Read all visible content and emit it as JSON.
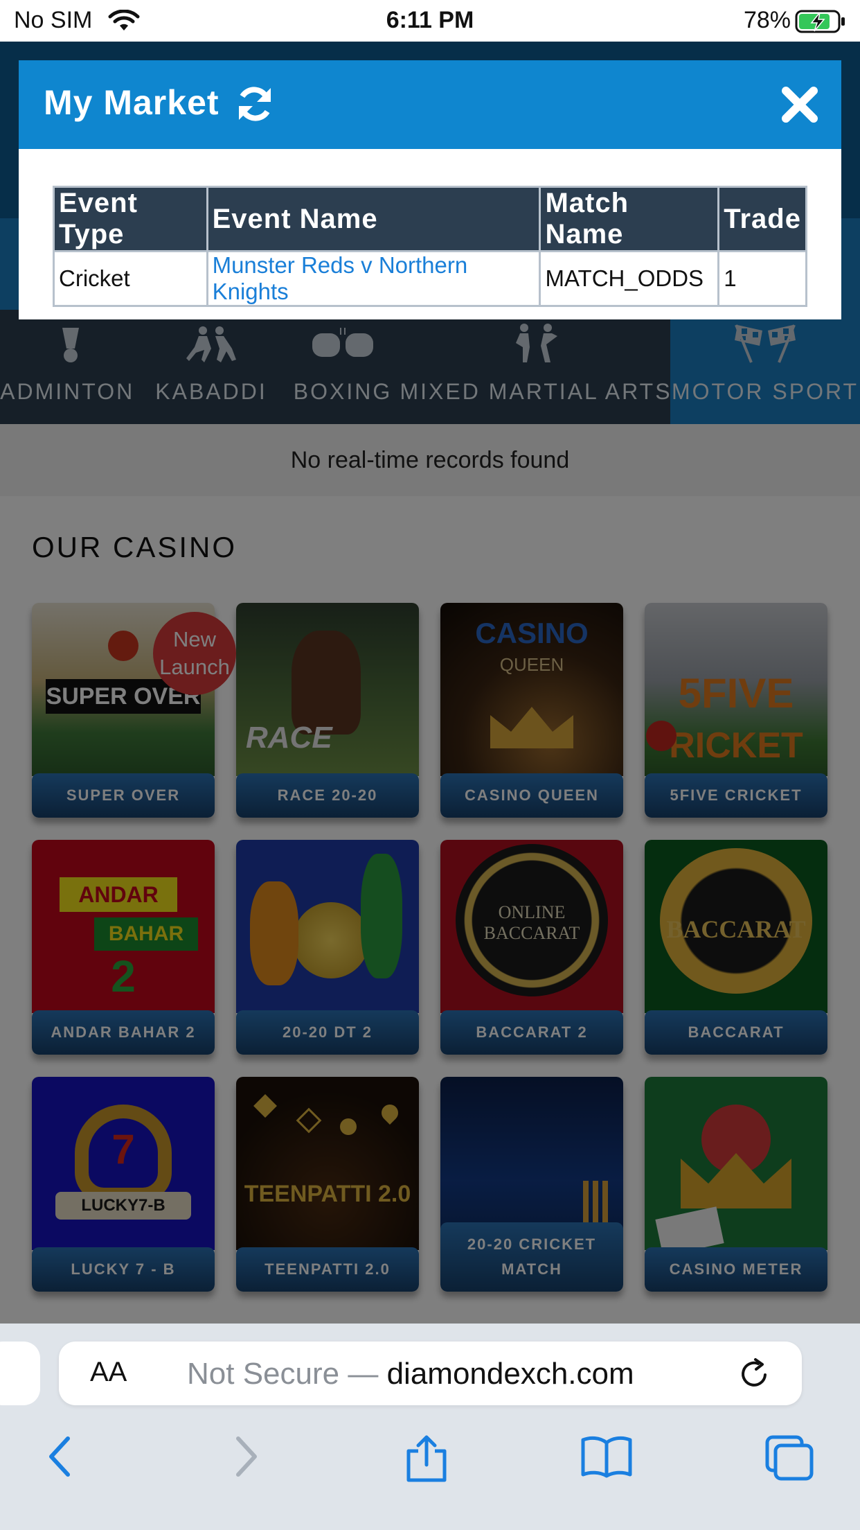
{
  "status_bar": {
    "carrier": "No SIM",
    "time": "6:11 PM",
    "battery": "78%"
  },
  "modal": {
    "title": "My Market",
    "table": {
      "headers": [
        "Event Type",
        "Event Name",
        "Match Name",
        "Trade"
      ],
      "rows": [
        [
          "Cricket",
          "Munster Reds v Northern Knights",
          "MATCH_ODDS",
          "1"
        ]
      ]
    }
  },
  "sports_nav": {
    "items": [
      {
        "label": "BADMINTON",
        "icon": "shuttlecock-icon"
      },
      {
        "label": "KABADDI",
        "icon": "kabaddi-icon"
      },
      {
        "label": "BOXING",
        "icon": "boxing-gloves-icon"
      },
      {
        "label": "MIXED MARTIAL ARTS",
        "icon": "martial-arts-icon"
      },
      {
        "label": "MOTOR SPORT",
        "icon": "checkered-flags-icon",
        "active": true
      }
    ]
  },
  "realtime_message": "No real-time records found",
  "casino": {
    "title": "OUR CASINO",
    "new_badge": [
      "New",
      "Launch"
    ],
    "games": [
      {
        "label": "SUPER OVER"
      },
      {
        "label": "RACE 20-20"
      },
      {
        "label": "CASINO QUEEN"
      },
      {
        "label": "5FIVE CRICKET"
      },
      {
        "label": "ANDAR BAHAR 2"
      },
      {
        "label": "20-20 DT 2"
      },
      {
        "label": "BACCARAT 2"
      },
      {
        "label": "BACCARAT"
      },
      {
        "label": "LUCKY 7 - B"
      },
      {
        "label": "TEENPATTI 2.0"
      },
      {
        "label": "20-20 CRICKET MATCH"
      },
      {
        "label": "CASINO METER"
      }
    ]
  },
  "safari": {
    "aa_label": "AA",
    "not_secure": "Not Secure —",
    "domain": "diamondexch.com"
  }
}
